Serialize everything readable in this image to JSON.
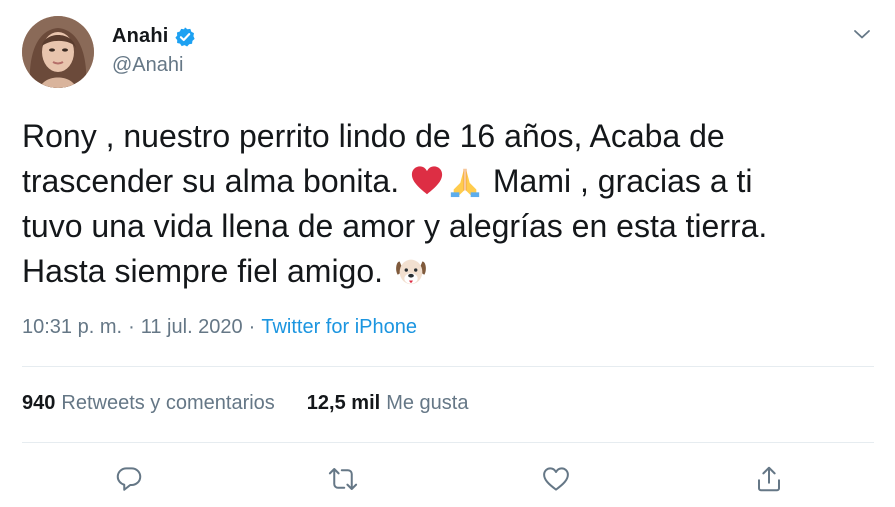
{
  "user": {
    "display_name": "Anahi",
    "handle": "@Anahi",
    "verified": true
  },
  "tweet": {
    "line1": "Rony , nuestro perrito lindo de 16 años, Acaba de",
    "line2_a": "trascender su alma bonita. ",
    "line2_b": " Mami , gracias a ti",
    "line3": "tuvo una vida llena de amor y alegrías en esta tierra.",
    "line4": "Hasta siempre fiel amigo. ",
    "emojis": [
      "red-heart",
      "folded-hands",
      "dog-face"
    ]
  },
  "meta": {
    "time": "10:31 p. m.",
    "separator1": "·",
    "date": "11 jul. 2020",
    "separator2": "·",
    "source": "Twitter for iPhone"
  },
  "stats": {
    "retweets_count": "940",
    "retweets_label": "Retweets y comentarios",
    "likes_count": "12,5 mil",
    "likes_label": "Me gusta"
  },
  "actions": [
    "reply-icon",
    "retweet-icon",
    "like-icon",
    "share-icon"
  ],
  "colors": {
    "text": "#14171a",
    "secondary": "#657786",
    "link": "#1b95e0",
    "divider": "#e6ecf0",
    "verified": "#1da1f2"
  }
}
